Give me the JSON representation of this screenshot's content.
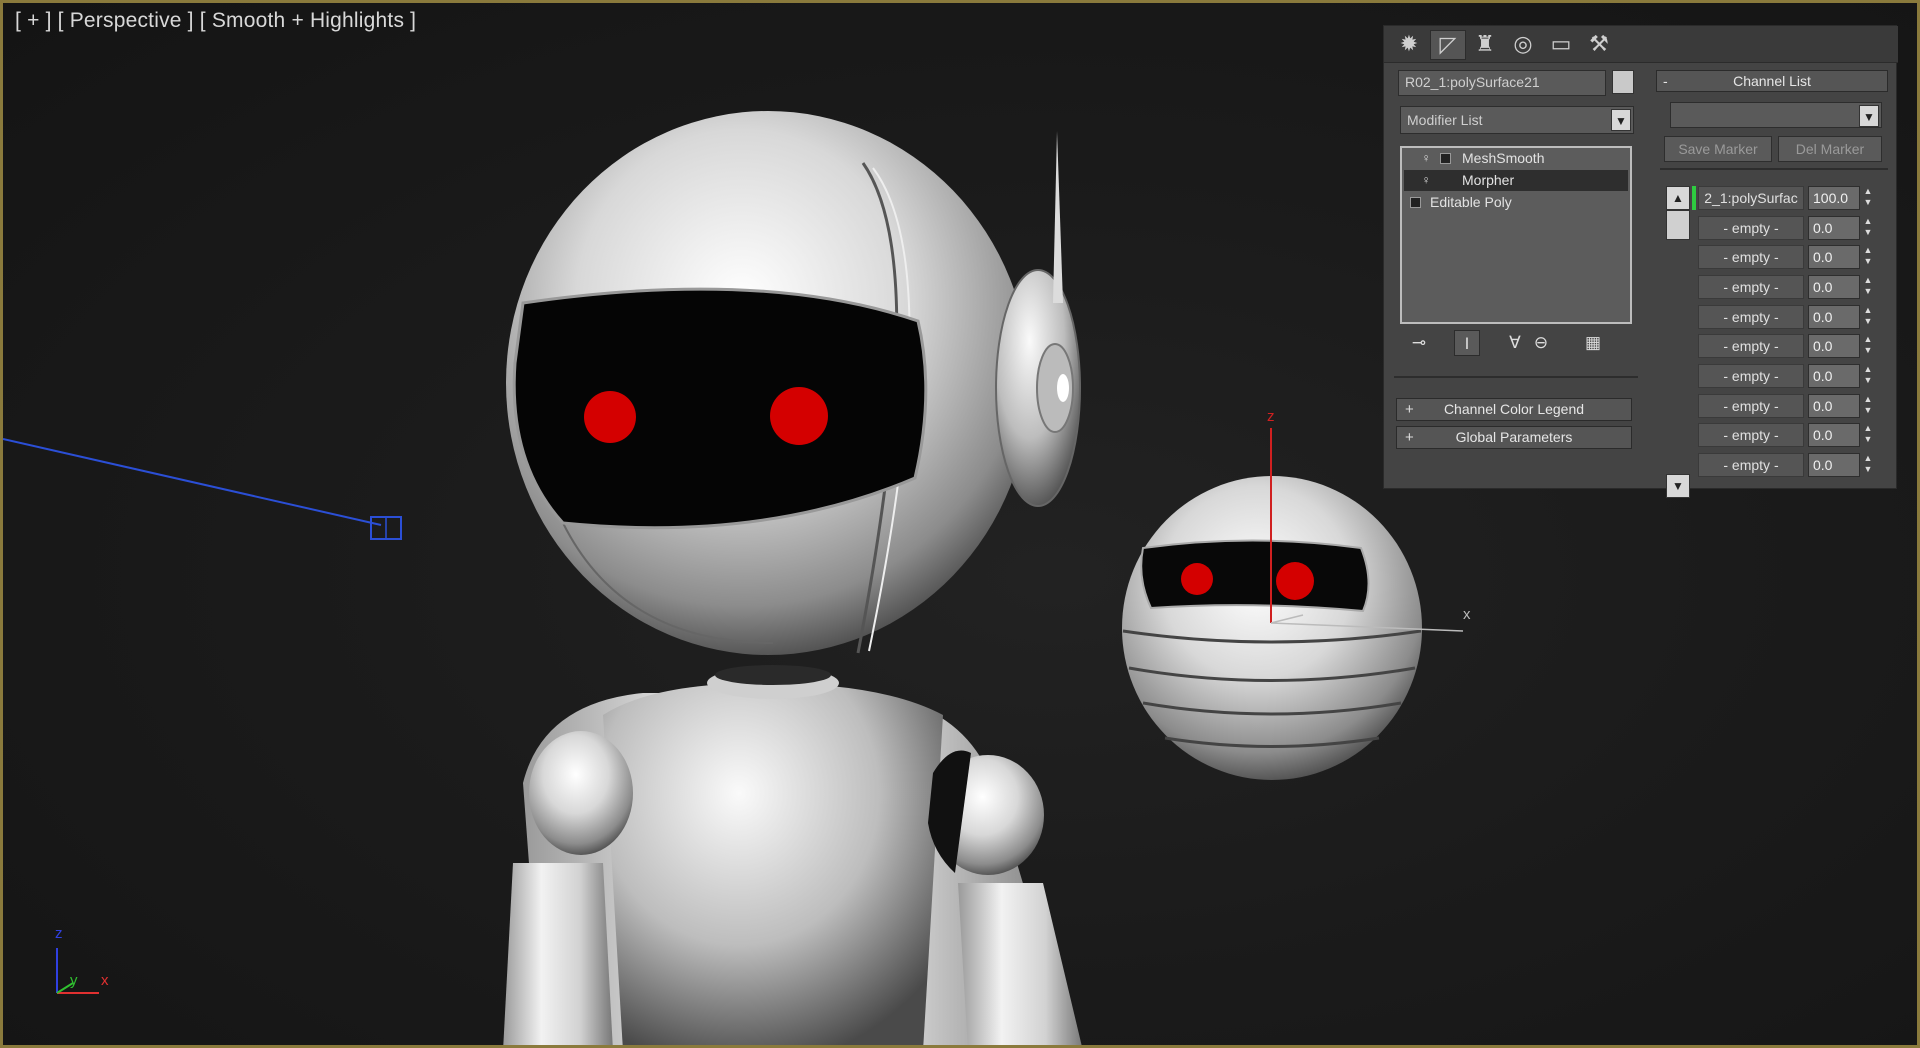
{
  "viewport": {
    "label_parts": [
      "[ + ]",
      "[ Perspective ]",
      "[ Smooth + Highlights ]"
    ],
    "gizmo_axes": {
      "z": "z",
      "x": "x"
    },
    "corner_axes": {
      "z": "z",
      "y": "y",
      "x": "x"
    }
  },
  "command_panel": {
    "tabs": [
      {
        "icon": "sun-icon",
        "glyph": "✹"
      },
      {
        "icon": "modify-icon",
        "glyph": "◸"
      },
      {
        "icon": "hierarchy-icon",
        "glyph": "♜"
      },
      {
        "icon": "motion-icon",
        "glyph": "◎"
      },
      {
        "icon": "display-icon",
        "glyph": "▭"
      },
      {
        "icon": "utilities-icon",
        "glyph": "⚒"
      }
    ],
    "object_name": "R02_1:polySurface21",
    "object_color": "#c9c9c9",
    "modifier_list_label": "Modifier List",
    "stack": [
      {
        "label": "MeshSmooth",
        "selected": false
      },
      {
        "label": "Morpher",
        "selected": true
      },
      {
        "label": "Editable Poly",
        "selected": false
      }
    ],
    "stack_tools": [
      {
        "icon": "pin-stack-icon",
        "glyph": "⊸"
      },
      {
        "icon": "show-end-result-icon",
        "glyph": "I"
      },
      {
        "icon": "make-unique-icon",
        "glyph": "∀"
      },
      {
        "icon": "remove-modifier-icon",
        "glyph": "⊖"
      },
      {
        "icon": "configure-modifier-sets-icon",
        "glyph": "▦"
      }
    ],
    "rollouts": [
      {
        "sign": "+",
        "label": "Channel Color Legend"
      },
      {
        "sign": "+",
        "label": "Global Parameters"
      }
    ],
    "channel_list": {
      "header_sign": "-",
      "header": "Channel List",
      "save_marker": "Save Marker",
      "del_marker": "Del Marker",
      "channels": [
        {
          "name": "2_1:polySurfac",
          "value": "100.0"
        },
        {
          "name": "- empty -",
          "value": "0.0"
        },
        {
          "name": "- empty -",
          "value": "0.0"
        },
        {
          "name": "- empty -",
          "value": "0.0"
        },
        {
          "name": "- empty -",
          "value": "0.0"
        },
        {
          "name": "- empty -",
          "value": "0.0"
        },
        {
          "name": "- empty -",
          "value": "0.0"
        },
        {
          "name": "- empty -",
          "value": "0.0"
        },
        {
          "name": "- empty -",
          "value": "0.0"
        },
        {
          "name": "- empty -",
          "value": "0.0"
        }
      ]
    }
  }
}
